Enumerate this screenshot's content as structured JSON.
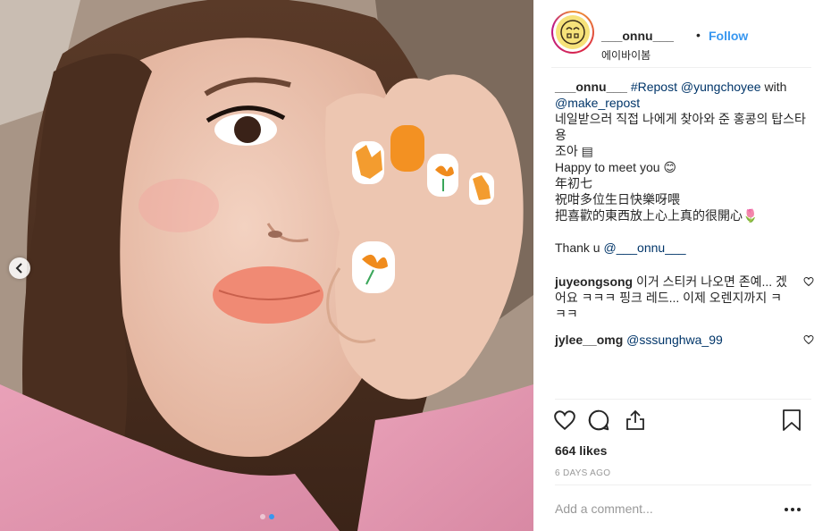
{
  "header": {
    "username": "___onnu___",
    "separator": "•",
    "follow_label": "Follow",
    "location": "에이바이봄",
    "avatar_text": "ᄒᄆ"
  },
  "caption": {
    "username": "___onnu___",
    "hashtag": "#Repost",
    "mention1": "@yungchoyee",
    "with_text": "with",
    "mention2": "@make_repost",
    "line1": "네일받으러 직접 나에게 찾아와 준 홍콩의 탑스타 용",
    "line2": "조아 ▤",
    "line3": "Happy to meet you 😊",
    "line4": "年初七",
    "line5": "祝咁多位生日快樂呀喂",
    "line6": "把喜歡的東西放上心上真的很開心🌷",
    "thanks_text": "Thank u",
    "thanks_mention": "@___onnu___"
  },
  "comments": [
    {
      "username": "juyeongsong",
      "text": "이거 스티커 나오면 존예... 겠어요 ㅋㅋㅋ 핑크 레드... 이제 오렌지까지 ㅋㅋㅋ"
    },
    {
      "username": "jylee__omg",
      "mention": "@sssunghwa_99"
    }
  ],
  "likes": "664 likes",
  "timestamp": "6 DAYS AGO",
  "add_comment": {
    "placeholder": "Add a comment..."
  },
  "carousel": {
    "total": 2,
    "active": 2
  },
  "colors": {
    "accent": "#3897f0",
    "mention": "#003569",
    "text": "#262626",
    "muted": "#999999",
    "divider": "#efefef"
  },
  "icons": [
    "chevron-left-icon",
    "heart-icon",
    "comment-icon",
    "share-icon",
    "bookmark-icon",
    "more-icon"
  ]
}
